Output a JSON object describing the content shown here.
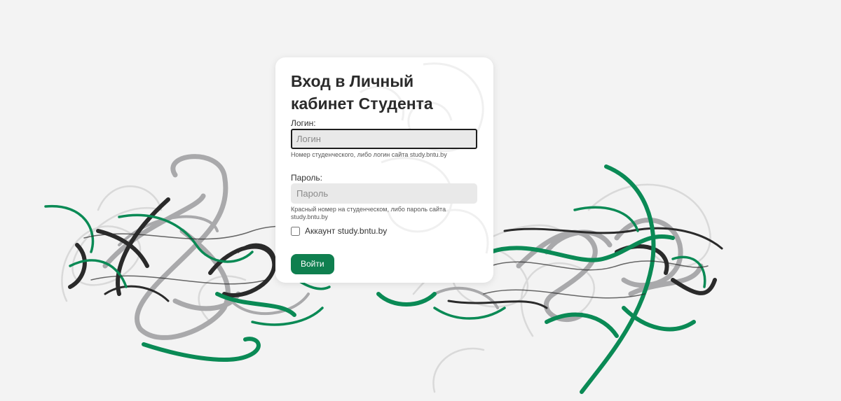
{
  "login_form": {
    "title": "Вход в Личный кабинет Студента",
    "login": {
      "label": "Логин:",
      "placeholder": "Логин",
      "value": "",
      "hint": "Номер студенческого, либо логин сайта study.bntu.by"
    },
    "password": {
      "label": "Пароль:",
      "placeholder": "Пароль",
      "value": "",
      "hint": "Красный номер на студенческом, либо пароль сайта study.bntu.by"
    },
    "study_account": {
      "label": "Аккаунт study.bntu.by",
      "checked": false
    },
    "submit_label": "Войти"
  },
  "colors": {
    "accent": "#0f7f4f",
    "scribble_green": "#0a8a55",
    "scribble_dark": "#2a2a2a",
    "scribble_gray": "#a9a9ab",
    "scribble_light": "#d9d9d9",
    "background": "#f3f3f3"
  }
}
